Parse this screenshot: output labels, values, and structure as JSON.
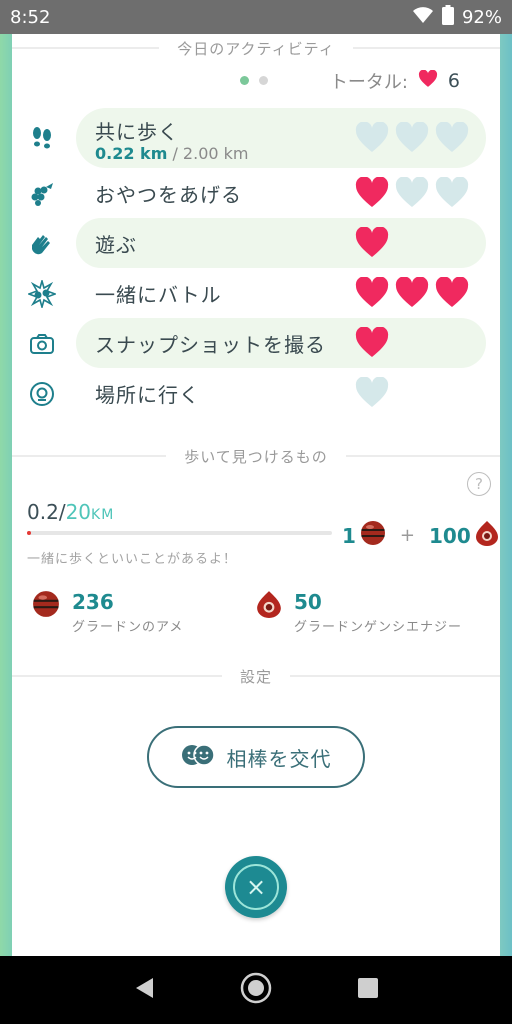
{
  "status_bar": {
    "time": "8:52",
    "battery": "92%"
  },
  "activities": {
    "title": "今日のアクティビティ",
    "total_label": "トータル:",
    "total_value": "6",
    "items": [
      {
        "label": "共に歩く",
        "progress_current": "0.22 km",
        "progress_total": " / 2.00 km",
        "icon": "footprints-icon",
        "hearts_filled": 0,
        "hearts_total": 3
      },
      {
        "label": "おやつをあげる",
        "icon": "berries-icon",
        "hearts_filled": 1,
        "hearts_total": 3
      },
      {
        "label": "遊ぶ",
        "icon": "hand-wave-icon",
        "hearts_filled": 1,
        "hearts_total": 1
      },
      {
        "label": "一緒にバトル",
        "icon": "battle-icon",
        "hearts_filled": 3,
        "hearts_total": 3
      },
      {
        "label": "スナップショットを撮る",
        "icon": "camera-icon",
        "hearts_filled": 1,
        "hearts_total": 1
      },
      {
        "label": "場所に行く",
        "icon": "location-icon",
        "hearts_filled": 0,
        "hearts_total": 1
      }
    ]
  },
  "walk": {
    "title": "歩いて見つけるもの",
    "help": "?",
    "current": "0.2",
    "slash": "/",
    "goal": "20",
    "unit": "KM",
    "progress_fraction": 0.01,
    "reward_candy": "1",
    "reward_plus": "+",
    "reward_energy": "100",
    "hint": "一緒に歩くといいことがあるよ！"
  },
  "inventory": {
    "candy_count": "236",
    "candy_label": "グラードンのアメ",
    "energy_count": "50",
    "energy_label": "グラードンゲンシエナジー"
  },
  "settings": {
    "title": "設定",
    "swap_button": "相棒を交代"
  },
  "close": {
    "symbol": "×"
  },
  "colors": {
    "heart_filled": "#f0295f",
    "heart_empty": "#d5e8ea",
    "teal": "#1e8a8f"
  }
}
